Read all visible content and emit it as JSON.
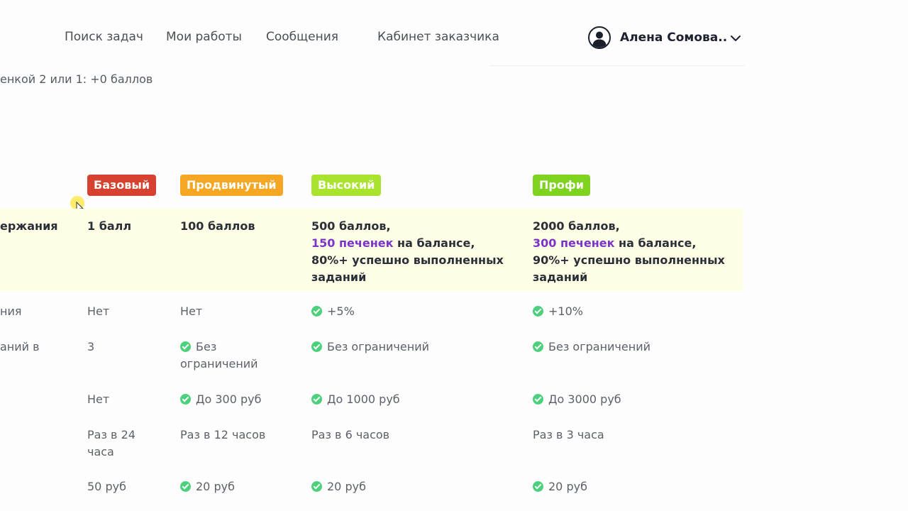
{
  "nav": {
    "links": [
      "Поиск задач",
      "Мои работы",
      "Сообщения",
      "Кабинет заказчика"
    ],
    "user_name": "Алена Сомова..",
    "avatar_icon": "user-avatar-icon",
    "dropdown_icon": "chevron-down-icon"
  },
  "hint_text": "енкой 2 или 1: +0 баллов",
  "levels": [
    {
      "name": "Базовый",
      "color": "#d7412f"
    },
    {
      "name": "Продвинутый",
      "color": "#f5a623"
    },
    {
      "name": "Высокий",
      "color": "#a9e32e"
    },
    {
      "name": "Профи",
      "color": "#7ed321"
    }
  ],
  "accent_color": "#7b33c8",
  "check_color": "#4cd07c",
  "requirements": {
    "label": "ержания",
    "base": "1 балл",
    "advanced": "100 баллов",
    "high": {
      "line1": "500 баллов,",
      "accent": "150 печенек",
      "after_accent": " на балансе,",
      "line3": "80%+ успешно выполненных",
      "line4": "заданий"
    },
    "pro": {
      "line1": "2000 баллов,",
      "accent": "300 печенек",
      "after_accent": " на балансе,",
      "line3": "90%+ успешно выполненных",
      "line4": "заданий"
    }
  },
  "rows": [
    {
      "label": "ния",
      "base": "Нет",
      "advanced": "Нет",
      "high": "+5%",
      "pro": "+10%"
    },
    {
      "label": "аний в",
      "base": "3",
      "advanced_line1": "Без",
      "advanced_line2": "ограничений",
      "high": "Без ограничений",
      "pro": "Без ограничений"
    },
    {
      "base": "Нет",
      "advanced": "До 300 руб",
      "high": "До 1000 руб",
      "pro": "До 3000 руб"
    },
    {
      "base_line1": "Раз в 24",
      "base_line2": "часа",
      "advanced": "Раз в 12 часов",
      "high": "Раз в 6 часов",
      "pro": "Раз в 3 часа"
    },
    {
      "base": "50 руб",
      "advanced": "20 руб",
      "high": "20 руб",
      "pro": "20 руб"
    }
  ]
}
